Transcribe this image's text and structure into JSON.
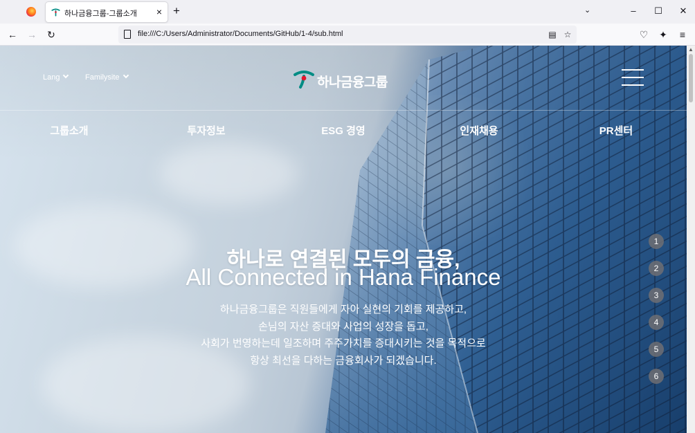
{
  "browser": {
    "tab_title": "하나금융그룹-그룹소개",
    "tab_close": "×",
    "new_tab": "+",
    "url": "file:///C:/Users/Administrator/Documents/GitHub/1-4/sub.html"
  },
  "header": {
    "lang_label": "Lang",
    "familysite_label": "Familysite",
    "logo_text": "하나금융그룹"
  },
  "gnb": {
    "items": [
      "그룹소개",
      "투자정보",
      "ESG 경영",
      "인재채용",
      "PR센터"
    ]
  },
  "hero": {
    "title_ko": "하나로 연결된 모두의 금융,",
    "title_en": "All Connected in Hana Finance",
    "description": [
      "하나금융그룹은 직원들에게 자아 실현의 기회를 제공하고,",
      "손님의 자산 증대와 사업의 성장을 돕고,",
      "사회가 번영하는데 일조하며 주주가치를 증대시키는 것을 목적으로",
      "항상 최선을 다하는 금융회사가 되겠습니다."
    ]
  },
  "pager": {
    "items": [
      "1",
      "2",
      "3",
      "4",
      "5",
      "6"
    ]
  },
  "colors": {
    "brand_green": "#008c84",
    "brand_red": "#e5162d",
    "chrome_bg": "#f0f0f4"
  }
}
